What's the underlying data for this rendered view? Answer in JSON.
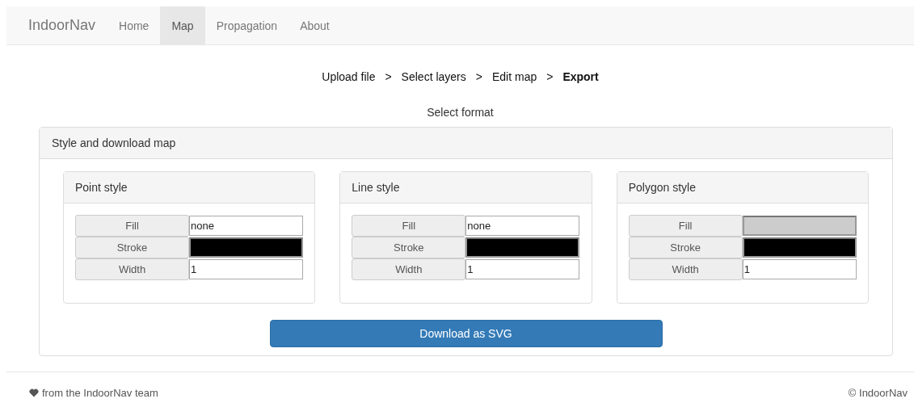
{
  "navbar": {
    "brand": "IndoorNav",
    "items": [
      {
        "label": "Home",
        "selected": false
      },
      {
        "label": "Map",
        "selected": true
      },
      {
        "label": "Propagation",
        "selected": false
      },
      {
        "label": "About",
        "selected": false
      }
    ]
  },
  "steps": [
    {
      "label": "Upload file",
      "selected": false
    },
    {
      "separator": ">",
      "label": "Select layers",
      "selected": false
    },
    {
      "separator": ">",
      "label": "Edit map",
      "selected": false
    },
    {
      "separator": ">",
      "label": "Export",
      "selected": true
    }
  ],
  "subtitle": "Select format",
  "panel": {
    "title": "Style and download map",
    "cards": [
      {
        "title": "Point style",
        "rows": [
          {
            "label": "Fill",
            "kind": "text",
            "value": "none"
          },
          {
            "label": "Stroke",
            "kind": "color",
            "color": "#000000"
          },
          {
            "label": "Width",
            "kind": "text",
            "value": "1"
          }
        ]
      },
      {
        "title": "Line style",
        "rows": [
          {
            "label": "Fill",
            "kind": "text",
            "value": "none"
          },
          {
            "label": "Stroke",
            "kind": "color",
            "color": "#000000"
          },
          {
            "label": "Width",
            "kind": "text",
            "value": "1"
          }
        ]
      },
      {
        "title": "Polygon style",
        "rows": [
          {
            "label": "Fill",
            "kind": "color",
            "color": "#cccccc"
          },
          {
            "label": "Stroke",
            "kind": "color",
            "color": "#000000"
          },
          {
            "label": "Width",
            "kind": "text",
            "value": "1"
          }
        ]
      }
    ],
    "button": "Download as SVG"
  },
  "footer": {
    "left": "from the IndoorNav team",
    "right": "© IndoorNav"
  }
}
